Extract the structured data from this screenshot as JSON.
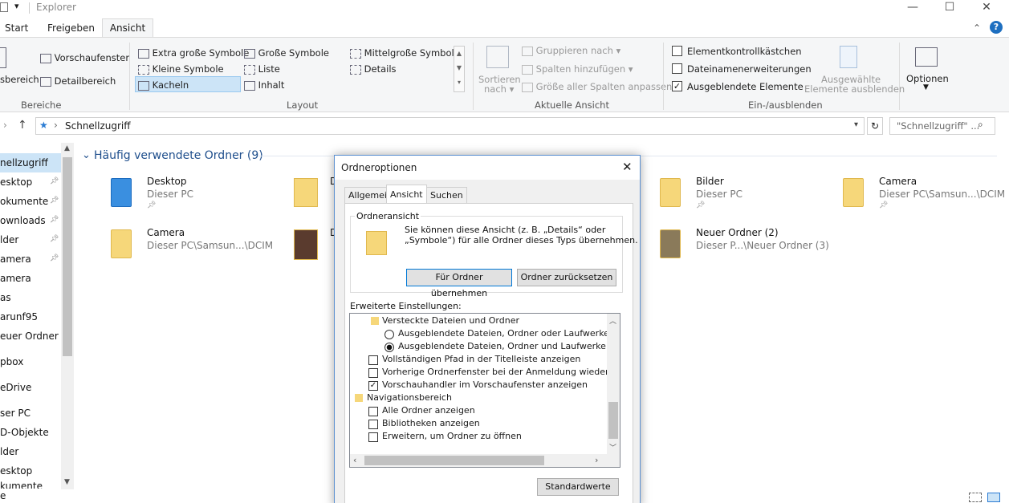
{
  "window": {
    "title": "Explorer",
    "minimize": "—",
    "maximize": "☐",
    "close": "✕"
  },
  "tabs": [
    "Start",
    "Freigeben",
    "Ansicht"
  ],
  "ribbon": {
    "bereiche": {
      "preview": "Vorschaufenster",
      "nav_partial": "sbereich",
      "details": "Detailbereich",
      "label": "Bereiche"
    },
    "layout": {
      "items": [
        "Extra große Symbole",
        "Große Symbole",
        "Mittelgroße Symbole",
        "Kleine Symbole",
        "Liste",
        "Details",
        "Kacheln",
        "Inhalt"
      ],
      "label": "Layout",
      "selected": "Kacheln"
    },
    "current": {
      "sort1": "Sortieren",
      "sort2": "nach",
      "group": "Gruppieren nach",
      "addcols": "Spalten hinzufügen",
      "fitcols": "Größe aller Spalten anpassen",
      "label": "Aktuelle Ansicht"
    },
    "show": {
      "cb1": "Elementkontrollkästchen",
      "cb2": "Dateinamenerweiterungen",
      "cb3": "Ausgeblendete Elemente",
      "hide1": "Ausgewählte",
      "hide2": "Elemente ausblenden",
      "label": "Ein-/ausblenden",
      "cb3_checked": "✓"
    },
    "options": "Optionen"
  },
  "address": {
    "path": "Schnellzugriff",
    "search_placeholder": "\"Schnellzugriff\" ..."
  },
  "nav": [
    "nellzugriff",
    "esktop",
    "okumente",
    "ownloads",
    "lder",
    "amera",
    "amera",
    "as",
    "arunf95",
    "euer Ordner (2)",
    "pbox",
    "eDrive",
    "ser PC",
    "D-Objekte",
    "lder",
    "esktop",
    "kumente",
    "e"
  ],
  "main": {
    "section": "Häufig verwendete Ordner (9)",
    "folders": [
      {
        "name": "Desktop",
        "sub": "Dieser PC"
      },
      {
        "name": "Bilder",
        "sub": "Dieser PC"
      },
      {
        "name": "Camera",
        "sub": "Dieser PC\\Samsun...\\DCIM"
      },
      {
        "name": "Camera",
        "sub": "Dieser PC\\Samsun...\\DCIM"
      },
      {
        "name": "Neuer Ordner (2)",
        "sub": "Dieser P...\\Neuer Ordner (3)"
      }
    ]
  },
  "dialog": {
    "title": "Ordneroptionen",
    "tabs": [
      "Allgemein",
      "Ansicht",
      "Suchen"
    ],
    "group": "Ordneransicht",
    "desc1": "Sie können diese Ansicht (z. B. „Details“ oder",
    "desc2": "„Symbole“) für alle Ordner dieses Typs übernehmen.",
    "btn_apply": "Für Ordner übernehmen",
    "btn_reset": "Ordner zurücksetzen",
    "advanced": "Erweiterte Einstellungen:",
    "tree": [
      {
        "type": "folder",
        "text": "Versteckte Dateien und Ordner"
      },
      {
        "type": "radio",
        "text": "Ausgeblendete Dateien, Ordner oder Laufwerke nicht a"
      },
      {
        "type": "radio",
        "text": "Ausgeblendete Dateien, Ordner und Laufwerke anzeige"
      },
      {
        "type": "check",
        "text": "Vollständigen Pfad in der Titelleiste anzeigen"
      },
      {
        "type": "check",
        "text": "Vorherige Ordnerfenster bei der Anmeldung wiederherstellen"
      },
      {
        "type": "check",
        "text": "Vorschauhandler im Vorschaufenster anzeigen"
      },
      {
        "type": "folder",
        "text": "Navigationsbereich"
      },
      {
        "type": "check",
        "text": "Alle Ordner anzeigen"
      },
      {
        "type": "check",
        "text": "Bibliotheken anzeigen"
      },
      {
        "type": "check",
        "text": "Erweitern, um Ordner zu öffnen"
      }
    ],
    "check_mark": "✓",
    "btn_default": "Standardwerte"
  }
}
